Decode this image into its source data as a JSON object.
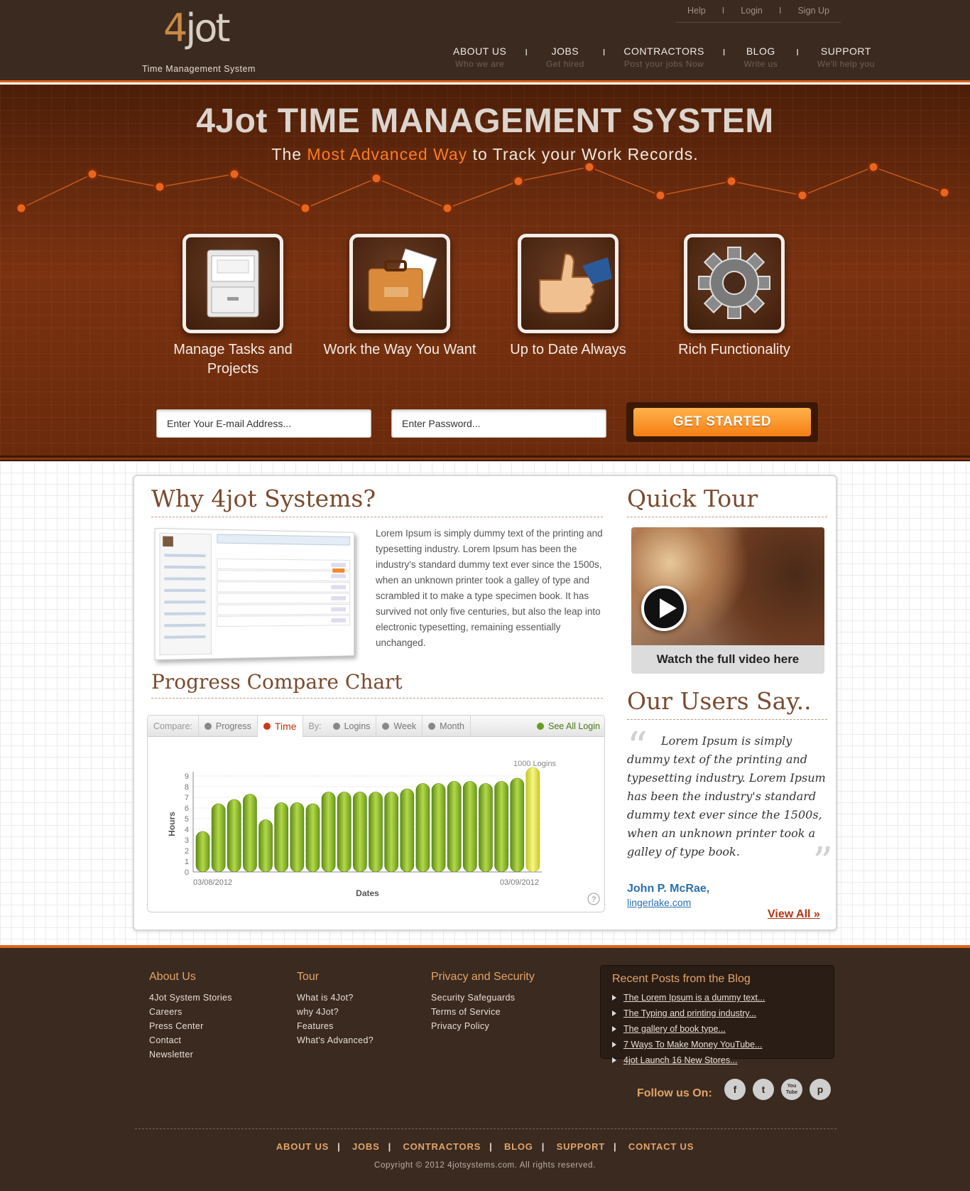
{
  "brand": {
    "logo_digit": "4",
    "logo_word": "jot",
    "tagline": "Time Management System"
  },
  "toplinks": [
    "Help",
    "Login",
    "Sign Up"
  ],
  "nav": [
    {
      "title": "ABOUT US",
      "sub": "Who we are"
    },
    {
      "title": "JOBS",
      "sub": "Get hired"
    },
    {
      "title": "CONTRACTORS",
      "sub": "Post your jobs Now"
    },
    {
      "title": "BLOG",
      "sub": "Write us"
    },
    {
      "title": "SUPPORT",
      "sub": "We'll help you"
    }
  ],
  "hero": {
    "title": "4Jot TIME MANAGEMENT SYSTEM",
    "sub_pre": "The ",
    "sub_hl": "Most Advanced Way",
    "sub_post": " to Track your Work Records.",
    "features": [
      {
        "label": "Manage Tasks and Projects",
        "icon": "file-cabinet-icon"
      },
      {
        "label": "Work the Way You Want",
        "icon": "briefcase-icon"
      },
      {
        "label": "Up to Date Always",
        "icon": "thumbs-up-icon"
      },
      {
        "label": "Rich Functionality",
        "icon": "gear-icon"
      }
    ],
    "email_placeholder": "Enter Your E-mail Address...",
    "password_placeholder": "Enter Password...",
    "cta": "GET STARTED"
  },
  "why": {
    "heading": "Why 4jot Systems?",
    "text": "Lorem Ipsum is simply dummy text of the printing and typesetting industry. Lorem Ipsum has been the industry's standard dummy text ever since the 1500s, when an unknown printer took a galley of type and scrambled it to make a type specimen book. It has survived not only five centuries, but also the leap into electronic typesetting, remaining essentially unchanged."
  },
  "progress": {
    "heading": "Progress Compare Chart",
    "toolbar": {
      "compare": "Compare:",
      "progress": "Progress",
      "time": "Time",
      "by": "By:",
      "logins": "Logins",
      "week": "Week",
      "month": "Month",
      "see_all": "See All Login"
    }
  },
  "chart_data": {
    "type": "bar",
    "ylabel": "Hours",
    "xlabel": "Dates",
    "ylim": [
      0,
      9
    ],
    "yticks": [
      0,
      1,
      2,
      3,
      4,
      5,
      6,
      7,
      8,
      9
    ],
    "x_start_label": "03/08/2012",
    "x_end_label": "03/09/2012",
    "values": [
      3.8,
      6.4,
      6.8,
      7.3,
      4.9,
      6.5,
      6.5,
      6.4,
      7.5,
      7.5,
      7.5,
      7.5,
      7.5,
      7.8,
      8.3,
      8.3,
      8.5,
      8.5,
      8.3,
      8.5,
      8.8,
      9.8
    ],
    "highlight_index": 21,
    "annotation": "1000 Logins"
  },
  "quicktour": {
    "heading": "Quick Tour",
    "caption": "Watch the full video here"
  },
  "users": {
    "heading": "Our Users Say..",
    "quote": "Lorem Ipsum is simply dummy text of the printing and typesetting industry. Lorem Ipsum has been the industry's standard dummy text ever since the 1500s, when an unknown printer took a galley of type book.",
    "author": "John P. McRae,",
    "site": "lingerlake.com",
    "view_all": "View All »"
  },
  "footer": {
    "about": {
      "title": "About Us",
      "items": [
        "4Jot System Stories",
        "Careers",
        "Press Center",
        "Contact",
        "Newsletter"
      ]
    },
    "tour": {
      "title": "Tour",
      "items": [
        "What is 4Jot?",
        "why 4Jot?",
        "Features",
        "What's Advanced?"
      ]
    },
    "privacy": {
      "title": "Privacy and Security",
      "items": [
        "Security Safeguards",
        "Terms of Service",
        "Privacy Policy"
      ]
    },
    "blog": {
      "title": "Recent Posts from the Blog",
      "items": [
        "The Lorem Ipsum is a dummy text...",
        "The Typing and printing industry...",
        "The gallery of book type...",
        "7 Ways To Make Money YouTube...",
        "4jot Launch 16 New Stores..."
      ]
    },
    "follow": "Follow us On:",
    "social": [
      "f",
      "t",
      "You Tube",
      "p"
    ],
    "nav": [
      "ABOUT US",
      "JOBS",
      "CONTRACTORS",
      "BLOG",
      "SUPPORT",
      "CONTACT US"
    ],
    "copyright": "Copyright © 2012 4jotsystems.com. All rights reserved."
  }
}
